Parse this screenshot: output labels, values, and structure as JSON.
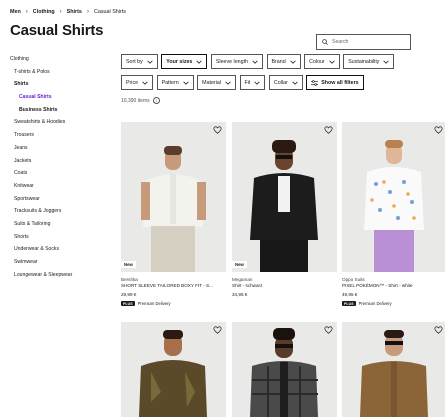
{
  "breadcrumb": [
    "Men",
    "Clothing",
    "Shirts",
    "Casual Shirts"
  ],
  "page_title": "Casual Shirts",
  "search": {
    "placeholder": "Search"
  },
  "sidebar": {
    "items": [
      {
        "label": "Clothing",
        "level": 0,
        "state": "normal"
      },
      {
        "label": "T-shirts & Polos",
        "level": 1,
        "state": "normal"
      },
      {
        "label": "Shirts",
        "level": 1,
        "state": "bold"
      },
      {
        "label": "Casual Shirts",
        "level": 2,
        "state": "active"
      },
      {
        "label": "Business Shirts",
        "level": 2,
        "state": "bold"
      },
      {
        "label": "Sweatshirts & Hoodies",
        "level": 1,
        "state": "normal"
      },
      {
        "label": "Trousers",
        "level": 1,
        "state": "normal"
      },
      {
        "label": "Jeans",
        "level": 1,
        "state": "normal"
      },
      {
        "label": "Jackets",
        "level": 1,
        "state": "normal"
      },
      {
        "label": "Coats",
        "level": 1,
        "state": "normal"
      },
      {
        "label": "Knitwear",
        "level": 1,
        "state": "normal"
      },
      {
        "label": "Sportswear",
        "level": 1,
        "state": "normal"
      },
      {
        "label": "Tracksuits & Joggers",
        "level": 1,
        "state": "normal"
      },
      {
        "label": "Suits & Tailoring",
        "level": 1,
        "state": "normal"
      },
      {
        "label": "Shorts",
        "level": 1,
        "state": "normal"
      },
      {
        "label": "Underwear & Socks",
        "level": 1,
        "state": "normal"
      },
      {
        "label": "Swimwear",
        "level": 1,
        "state": "normal"
      },
      {
        "label": "Loungewear & Sleepwear",
        "level": 1,
        "state": "normal"
      }
    ]
  },
  "filters": {
    "row1": [
      {
        "label": "Sort by",
        "strong": false
      },
      {
        "label": "Your sizes",
        "strong": true
      },
      {
        "label": "Sleeve length",
        "strong": false
      },
      {
        "label": "Brand",
        "strong": false
      },
      {
        "label": "Colour",
        "strong": false
      },
      {
        "label": "Sustainability",
        "strong": false
      }
    ],
    "row2": [
      {
        "label": "Price",
        "strong": false
      },
      {
        "label": "Pattern",
        "strong": false
      },
      {
        "label": "Material",
        "strong": false
      },
      {
        "label": "Fit",
        "strong": false
      },
      {
        "label": "Collar",
        "strong": false
      }
    ],
    "show_all": "Show all filters"
  },
  "item_count": "10,390 items",
  "products": [
    {
      "brand": "Bershka",
      "name": "SHORT SLEEVE TAILORED BOXY FIT - S...",
      "price": "29,99 €",
      "badge": "New",
      "plus_label": "PLUS",
      "delivery": "Premium Delivery",
      "img": "img-1"
    },
    {
      "brand": "Megaman",
      "name": "Shirt - schwarz",
      "price": "34,95 €",
      "badge": "New",
      "plus_label": "",
      "delivery": "",
      "img": "img-2"
    },
    {
      "brand": "Oppo Suits",
      "name": "PIXEL POKÉMON™ - Shirt - white",
      "price": "49,95 €",
      "badge": "",
      "plus_label": "PLUS",
      "delivery": "Premium Delivery",
      "img": "img-3"
    }
  ],
  "products_row2": [
    {
      "img": "img-4"
    },
    {
      "img": "img-5"
    },
    {
      "img": "img-6"
    }
  ],
  "colors": {
    "accent": "#6a24d6",
    "text": "#1a1a1a"
  }
}
